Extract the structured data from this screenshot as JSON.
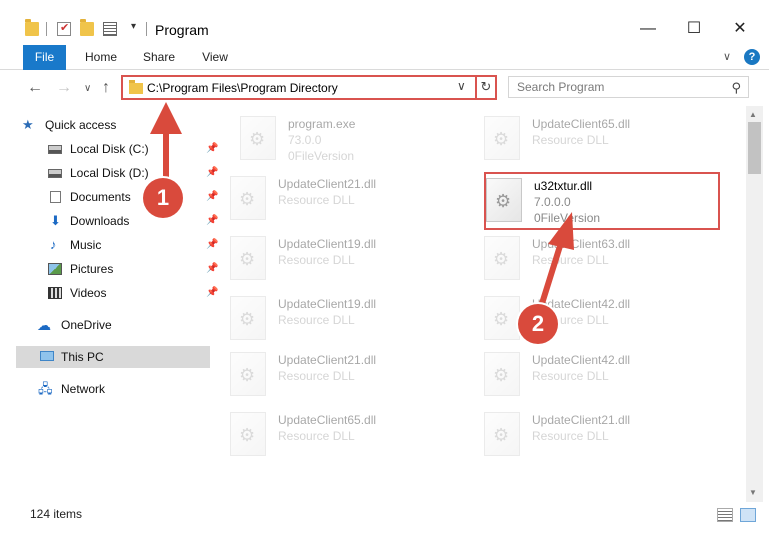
{
  "window": {
    "title": "Program",
    "minimize_glyph": "—",
    "maximize_glyph": "☐",
    "close_glyph": "✕"
  },
  "ribbon": {
    "tabs": [
      {
        "label": "File"
      },
      {
        "label": "Home"
      },
      {
        "label": "Share"
      },
      {
        "label": "View"
      }
    ],
    "collapse_glyph": "∨",
    "help_glyph": "?"
  },
  "nav": {
    "back_glyph": "←",
    "forward_glyph": "→",
    "recent_glyph": "∨",
    "up_glyph": "↑",
    "address": "C:\\Program Files\\Program Directory",
    "address_dropdown_glyph": "∨",
    "refresh_glyph": "↻",
    "search_placeholder": "Search Program",
    "search_glyph": "⚲"
  },
  "sidebar": {
    "items": [
      {
        "label": "Quick access",
        "icon": "star-icon",
        "pinned": false
      },
      {
        "label": "Local Disk (C:)",
        "icon": "drive-icon",
        "pinned": true
      },
      {
        "label": "Local Disk (D:)",
        "icon": "drive-icon",
        "pinned": true
      },
      {
        "label": "Documents",
        "icon": "documents-icon",
        "pinned": true
      },
      {
        "label": "Downloads",
        "icon": "download-icon",
        "pinned": true
      },
      {
        "label": "Music",
        "icon": "music-icon",
        "pinned": true
      },
      {
        "label": "Pictures",
        "icon": "pictures-icon",
        "pinned": true
      },
      {
        "label": "Videos",
        "icon": "videos-icon",
        "pinned": true
      },
      {
        "label": "OneDrive",
        "icon": "cloud-icon",
        "pinned": false
      },
      {
        "label": "This PC",
        "icon": "pc-icon",
        "pinned": false,
        "selected": true
      },
      {
        "label": "Network",
        "icon": "network-icon",
        "pinned": false
      }
    ],
    "pin_glyph": "📌"
  },
  "files": {
    "left_column": [
      {
        "name": "program.exe",
        "line2": "73.0.0",
        "line3": "0FileVersion"
      },
      {
        "name": "UpdateClient21.dll",
        "line2": "Resource DLL"
      },
      {
        "name": "UpdateClient19.dll",
        "line2": "Resource DLL"
      },
      {
        "name": "UpdateClient19.dll",
        "line2": "Resource DLL"
      },
      {
        "name": "UpdateClient21.dll",
        "line2": "Resource DLL"
      },
      {
        "name": "UpdateClient65.dll",
        "line2": "Resource DLL"
      }
    ],
    "right_column": [
      {
        "name": "UpdateClient65.dll",
        "line2": "Resource DLL"
      },
      {
        "name": "u32txtur.dll",
        "line2": "7.0.0.0",
        "line3": "0FileVersion",
        "highlighted": true
      },
      {
        "name": "UpdateClient63.dll",
        "line2": "Resource DLL"
      },
      {
        "name": "UpdateClient42.dll",
        "line2": "Resource DLL"
      },
      {
        "name": "UpdateClient42.dll",
        "line2": "Resource DLL"
      },
      {
        "name": "UpdateClient21.dll",
        "line2": "Resource DLL"
      }
    ]
  },
  "status": {
    "item_count": "124 items"
  },
  "annotations": {
    "step1": "1",
    "step2": "2",
    "color": "#d94a3c"
  }
}
